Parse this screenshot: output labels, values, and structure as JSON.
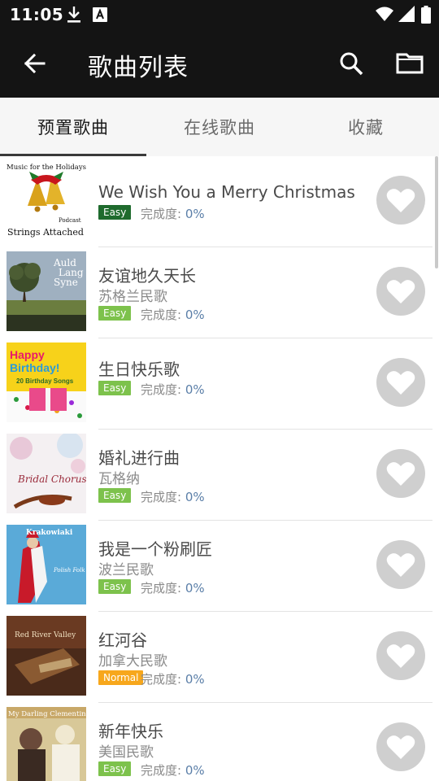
{
  "status_bar": {
    "time": "11:05",
    "icons": [
      "download-icon",
      "a-notification-icon",
      "wifi-icon",
      "signal-icon",
      "battery-icon"
    ]
  },
  "app_bar": {
    "title": "歌曲列表",
    "actions": [
      "back-icon",
      "search-icon",
      "folder-icon"
    ]
  },
  "tabs": [
    {
      "label": "预置歌曲",
      "active": true
    },
    {
      "label": "在线歌曲",
      "active": false
    },
    {
      "label": "收藏",
      "active": false
    }
  ],
  "progress_label": "完成度: ",
  "colors": {
    "easy": "#1f6b2e",
    "easy_light": "#7dc24c",
    "normal": "#f7a71c",
    "percent": "#5b7fa8"
  },
  "songs": [
    {
      "title": "We Wish You a Merry Christmas",
      "subtitle": "",
      "difficulty": "Easy",
      "progress": "0%"
    },
    {
      "title": "友谊地久天长",
      "subtitle": "苏格兰民歌",
      "difficulty": "Easy",
      "progress": "0%"
    },
    {
      "title": "生日快乐歌",
      "subtitle": "",
      "difficulty": "Easy",
      "progress": "0%"
    },
    {
      "title": "婚礼进行曲",
      "subtitle": "瓦格纳",
      "difficulty": "Easy",
      "progress": "0%"
    },
    {
      "title": "我是一个粉刷匠",
      "subtitle": "波兰民歌",
      "difficulty": "Easy",
      "progress": "0%"
    },
    {
      "title": "红河谷",
      "subtitle": "加拿大民歌",
      "difficulty": "Normal",
      "progress": "0%"
    },
    {
      "title": "新年快乐",
      "subtitle": "美国民歌",
      "difficulty": "Easy",
      "progress": "0%"
    }
  ],
  "covers": [
    {
      "top": "Music for the Holidays",
      "mid": "Podcast",
      "bottom": "Strings Attached"
    },
    {
      "line1": "Auld",
      "line2": "Lang",
      "line3": "Syne"
    },
    {
      "line1": "Happy",
      "line2": "Birthday!",
      "line3": "20 Birthday Songs"
    },
    {
      "line1": "Bridal Chorus"
    },
    {
      "line1": "Krakowiaki",
      "line2": "Polish Folk Music"
    },
    {
      "line1": "Red River Valley"
    },
    {
      "line1": "My Darling Clementine"
    }
  ]
}
